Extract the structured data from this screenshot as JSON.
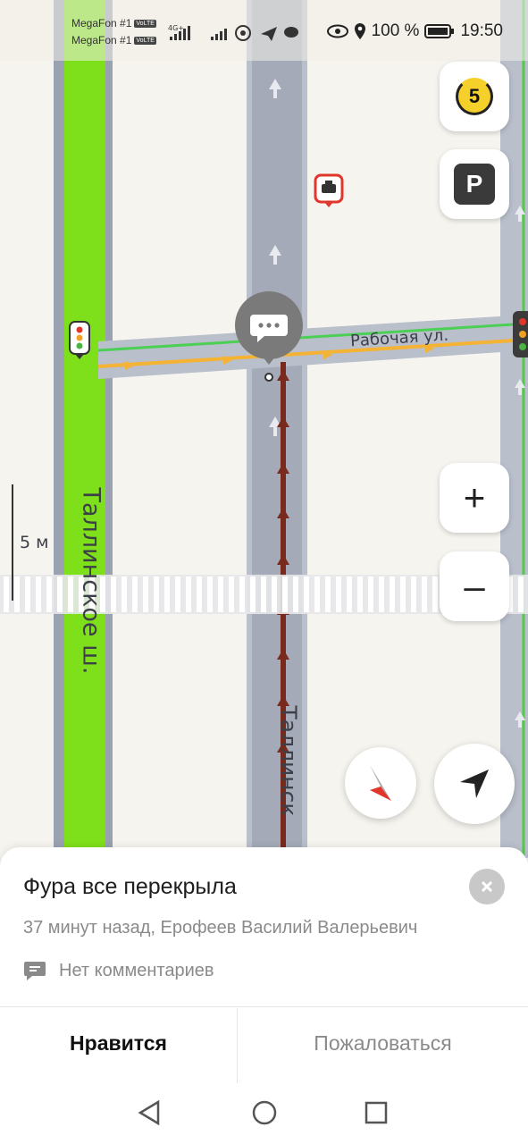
{
  "status_bar": {
    "carrier_1": "MegaFon #1",
    "carrier_2": "MegaFon #1",
    "volte": "VoLTE",
    "battery": "100 %",
    "time": "19:50"
  },
  "map": {
    "street_vertical_main": "Таллинское ш.",
    "street_vertical_second": "Таллинск",
    "street_horizontal": "Рабочая ул.",
    "scale_label": "5 м",
    "accent_green": "#7ee01a",
    "road_gray": "#9aa1b0",
    "route_color": "#7a2a1c"
  },
  "controls": {
    "level_badge": "5",
    "parking_label": "P",
    "zoom_in_label": "+",
    "zoom_out_label": "–",
    "level_color": "#f6d02a"
  },
  "event": {
    "title": "Фура все перекрыла",
    "meta": "37 минут назад, Ерофеев Василий Валерьевич",
    "comments": "Нет комментариев",
    "like_label": "Нравится",
    "report_label": "Пожаловаться"
  }
}
